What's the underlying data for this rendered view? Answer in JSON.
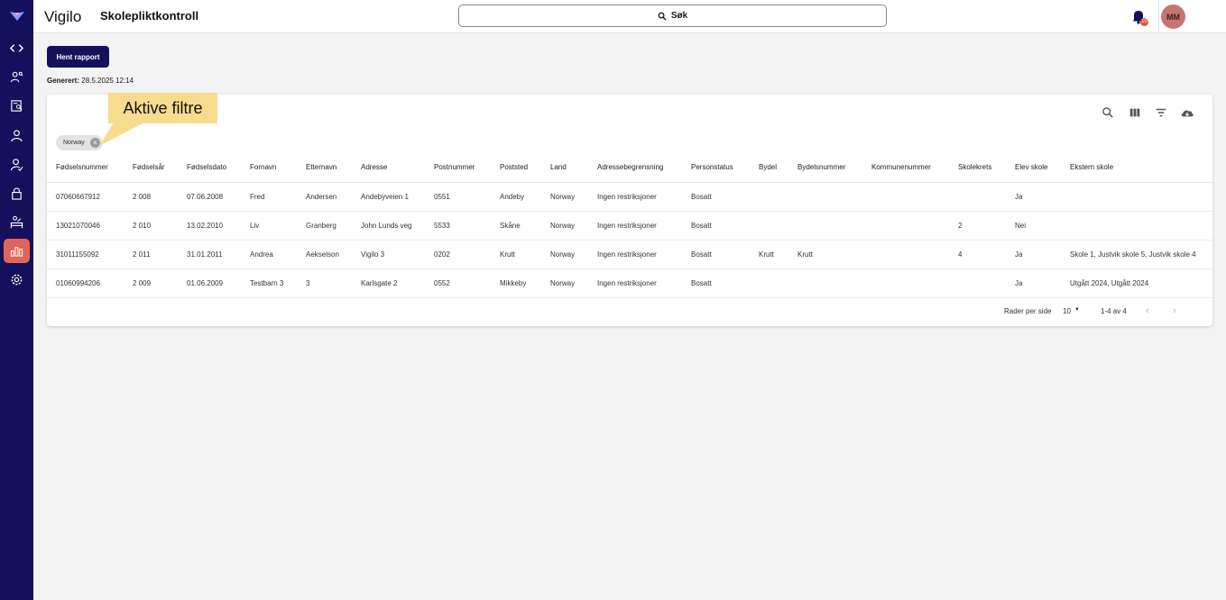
{
  "app": {
    "name": "Vigilo",
    "page_title": "Skolepliktkontroll"
  },
  "search": {
    "label": "Søk"
  },
  "notifications": {
    "badge": "10"
  },
  "user": {
    "initials": "MM"
  },
  "sidebar": {
    "items": [
      {
        "name": "code"
      },
      {
        "name": "people-search"
      },
      {
        "name": "document-person"
      },
      {
        "name": "person"
      },
      {
        "name": "person-check"
      },
      {
        "name": "lock"
      },
      {
        "name": "classroom"
      },
      {
        "name": "bar-chart",
        "active": true
      },
      {
        "name": "settings"
      }
    ]
  },
  "report": {
    "button_label": "Hent rapport",
    "generated_label": "Generert:",
    "generated_value": "28.5.2025 12:14"
  },
  "filters": {
    "chips": [
      "Norway"
    ]
  },
  "callout": {
    "text": "Aktive filtre"
  },
  "table": {
    "columns": [
      "Fødselsnummer",
      "Fødselsår",
      "Fødselsdato",
      "Fornavn",
      "Etternavn",
      "Adresse",
      "Postnummer",
      "Poststed",
      "Land",
      "Adressebegrensning",
      "Personstatus",
      "Bydel",
      "Bydelsnummer",
      "Kommunenummer",
      "Skolekrets",
      "Elev skole",
      "Ekstern skole"
    ],
    "rows": [
      [
        "07060667912",
        "2 008",
        "07.06.2008",
        "Fred",
        "Andersen",
        "Andebyveien 1",
        "0551",
        "Andeby",
        "Norway",
        "Ingen restriksjoner",
        "Bosatt",
        "",
        "",
        "",
        "",
        "Ja",
        ""
      ],
      [
        "13021070046",
        "2 010",
        "13.02.2010",
        "Liv",
        "Granberg",
        "John Lunds veg",
        "5533",
        "Skåne",
        "Norway",
        "Ingen restriksjoner",
        "Bosatt",
        "",
        "",
        "",
        "2",
        "Nei",
        ""
      ],
      [
        "31011155092",
        "2 011",
        "31.01.2011",
        "Andrea",
        "Aekselson",
        "Vigilo 3",
        "0202",
        "Krutt",
        "Norway",
        "Ingen restriksjoner",
        "Bosatt",
        "Krutt",
        "Krutt",
        "",
        "4",
        "Ja",
        "Skole 1, Justvik skole 5, Justvik skole 4"
      ],
      [
        "01060994206",
        "2 009",
        "01.06.2009",
        "Testbarn 3",
        "3",
        "Karlsgate 2",
        "0552",
        "Mikkeby",
        "Norway",
        "Ingen restriksjoner",
        "Bosatt",
        "",
        "",
        "",
        "",
        "Ja",
        "Utgått 2024, Utgått 2024"
      ]
    ]
  },
  "pagination": {
    "rows_per_page_label": "Rader per side",
    "rows_per_page": "10",
    "range": "1-4 av 4"
  },
  "colors": {
    "sidebar": "#15105c",
    "active_nav": "#e0655a",
    "callout": "#f7dc8d",
    "avatar": "#c77572"
  }
}
